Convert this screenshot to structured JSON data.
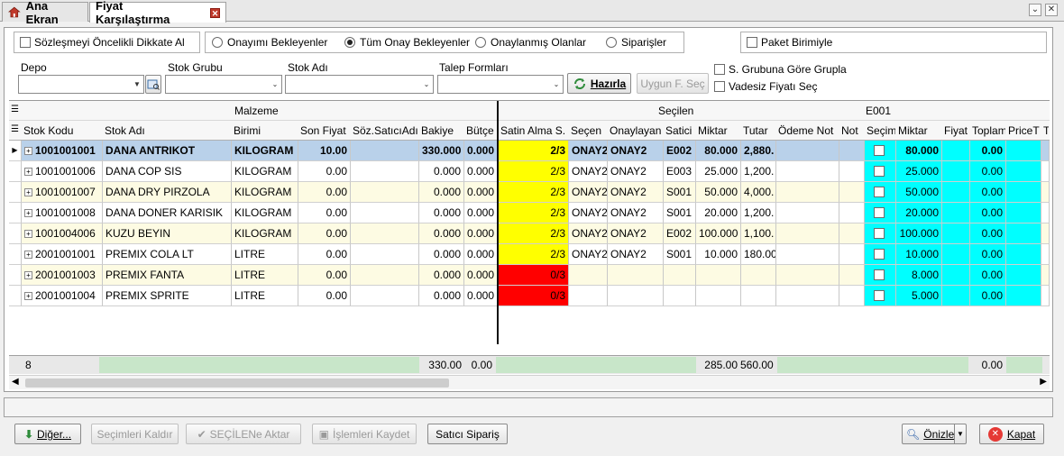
{
  "tabs": [
    {
      "label": "Ana Ekran",
      "icon": "home-icon"
    },
    {
      "label": "Fiyat Karşılaştırma",
      "icon": "close-icon"
    }
  ],
  "filters": {
    "priority_label": "Sözleşmeyi Öncelikli Dikkate Al",
    "radios": [
      "Onayımı Bekleyenler",
      "Tüm Onay Bekleyenler",
      "Onaylanmış Olanlar",
      "Siparişler"
    ],
    "selected_radio": "Tüm Onay Bekleyenler",
    "package_unit_label": "Paket Birimiyle",
    "depo_label": "Depo",
    "stok_grubu_label": "Stok Grubu",
    "stok_adi_label": "Stok Adı",
    "talep_formlari_label": "Talep Formları",
    "hazirla_button": "Hazırla",
    "uygun_fiyat_button": "Uygun F. Seç",
    "group_by_label": "S. Grubuna Göre Grupla",
    "vadesiz_label": "Vadesiz Fiyatı Seç"
  },
  "grid": {
    "band_malzeme": "Malzeme",
    "band_secilen": "Seçilen",
    "band_e001": "E001",
    "columns": [
      "Stok Kodu",
      "Stok Adı",
      "Birimi",
      "Son Fiyat",
      "Söz.SatıcıAdı",
      "Bakiye",
      "Bütçe",
      "Satin Alma S.",
      "Seçen",
      "Onaylayan",
      "Satici",
      "Miktar",
      "Tutar",
      "Ödeme Not",
      "Not",
      "Seçim",
      "Miktar",
      "Fiyat",
      "Toplam",
      "PriceT",
      "To"
    ],
    "rows": [
      {
        "kod": "1001001001",
        "ad": "DANA ANTRIKOT",
        "birim": "KILOGRAM",
        "son_fiyat": "10.00",
        "bakiye": "330.000",
        "butce": "0.000",
        "satin": "2/3",
        "secen": "ONAY2",
        "onaylayan": "ONAY2",
        "satici": "E002",
        "miktar": "80.000",
        "tutar": "2,880.",
        "e_miktar": "80.000",
        "toplam": "0.00"
      },
      {
        "kod": "1001001006",
        "ad": "DANA COP SIS",
        "birim": "KILOGRAM",
        "son_fiyat": "0.00",
        "bakiye": "0.000",
        "butce": "0.000",
        "satin": "2/3",
        "secen": "ONAY2",
        "onaylayan": "ONAY2",
        "satici": "E003",
        "miktar": "25.000",
        "tutar": "1,200.",
        "e_miktar": "25.000",
        "toplam": "0.00"
      },
      {
        "kod": "1001001007",
        "ad": "DANA DRY PIRZOLA",
        "birim": "KILOGRAM",
        "son_fiyat": "0.00",
        "bakiye": "0.000",
        "butce": "0.000",
        "satin": "2/3",
        "secen": "ONAY2",
        "onaylayan": "ONAY2",
        "satici": "S001",
        "miktar": "50.000",
        "tutar": "4,000.",
        "e_miktar": "50.000",
        "toplam": "0.00"
      },
      {
        "kod": "1001001008",
        "ad": "DANA DONER KARISIK",
        "birim": "KILOGRAM",
        "son_fiyat": "0.00",
        "bakiye": "0.000",
        "butce": "0.000",
        "satin": "2/3",
        "secen": "ONAY2",
        "onaylayan": "ONAY2",
        "satici": "S001",
        "miktar": "20.000",
        "tutar": "1,200.",
        "e_miktar": "20.000",
        "toplam": "0.00"
      },
      {
        "kod": "1001004006",
        "ad": "KUZU BEYIN",
        "birim": "KILOGRAM",
        "son_fiyat": "0.00",
        "bakiye": "0.000",
        "butce": "0.000",
        "satin": "2/3",
        "secen": "ONAY2",
        "onaylayan": "ONAY2",
        "satici": "E002",
        "miktar": "100.000",
        "tutar": "1,100.",
        "e_miktar": "100.000",
        "toplam": "0.00"
      },
      {
        "kod": "2001001001",
        "ad": "PREMIX COLA LT",
        "birim": "LITRE",
        "son_fiyat": "0.00",
        "bakiye": "0.000",
        "butce": "0.000",
        "satin": "2/3",
        "secen": "ONAY2",
        "onaylayan": "ONAY2",
        "satici": "S001",
        "miktar": "10.000",
        "tutar": "180.00",
        "e_miktar": "10.000",
        "toplam": "0.00"
      },
      {
        "kod": "2001001003",
        "ad": "PREMIX FANTA",
        "birim": "LITRE",
        "son_fiyat": "0.00",
        "bakiye": "0.000",
        "butce": "0.000",
        "satin": "0/3",
        "secen": "",
        "onaylayan": "",
        "satici": "",
        "miktar": "",
        "tutar": "",
        "e_miktar": "8.000",
        "toplam": "0.00"
      },
      {
        "kod": "2001001004",
        "ad": "PREMIX SPRITE",
        "birim": "LITRE",
        "son_fiyat": "0.00",
        "bakiye": "0.000",
        "butce": "0.000",
        "satin": "0/3",
        "secen": "",
        "onaylayan": "",
        "satici": "",
        "miktar": "",
        "tutar": "",
        "e_miktar": "5.000",
        "toplam": "0.00"
      }
    ],
    "footer": {
      "count": "8",
      "bakiye": "330.00",
      "butce": "0.00",
      "miktar": "285.00",
      "tutar": "560.00",
      "toplam": "0.00"
    }
  },
  "bottom": {
    "diger": "Diğer...",
    "secimleri_kaldir": "Seçimleri Kaldır",
    "secilen_aktar": "SEÇİLENe Aktar",
    "islemleri_kaydet": "İşlemleri Kaydet",
    "satici_siparis": "Satıcı Sipariş",
    "onizle": "Önizle",
    "kapat": "Kapat"
  },
  "colors": {
    "selected_row": "#b9d1ea",
    "alt_row": "#fdfbe3",
    "yellow": "#ffff00",
    "red": "#ff0000",
    "cyan": "#00ffff",
    "footer_green": "#c8e6c9"
  }
}
